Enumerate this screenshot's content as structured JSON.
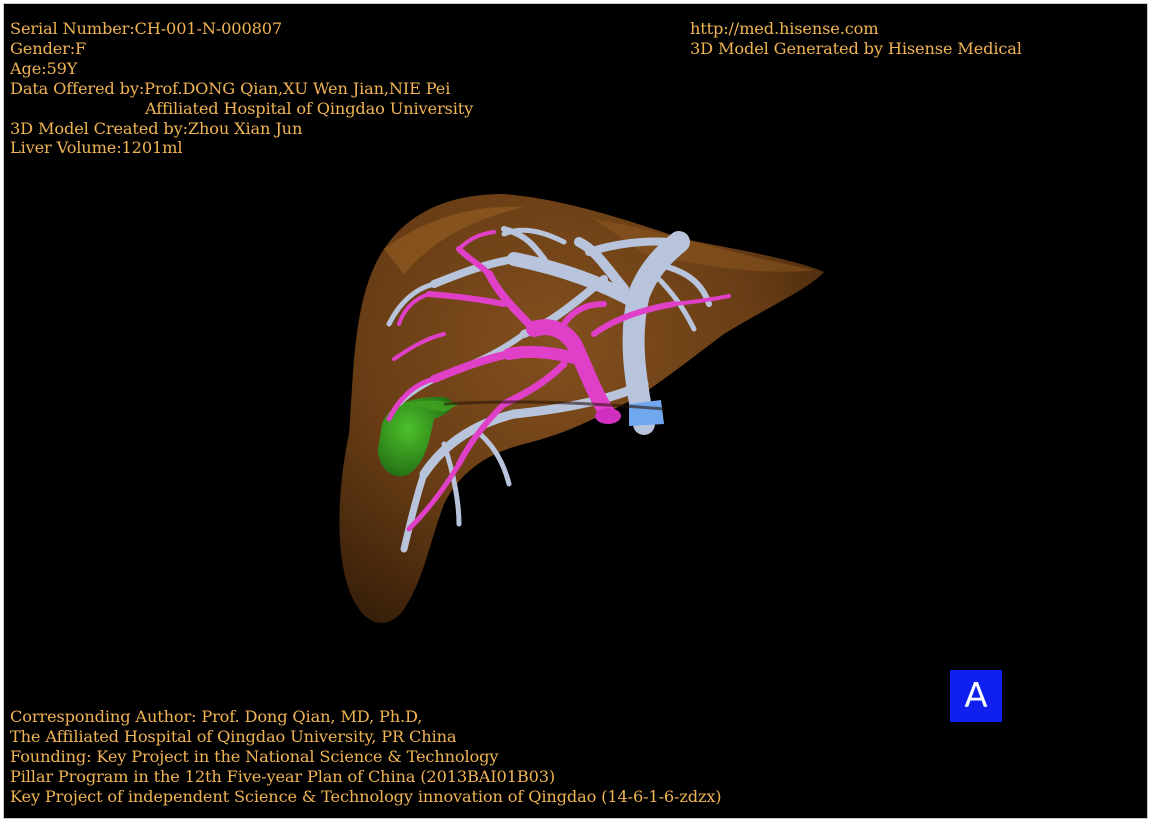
{
  "header_left": {
    "serial_number": "Serial Number:CH-001-N-000807",
    "gender": "Gender:F",
    "age": "Age:59Y",
    "data_offered_by": "Data Offered by:Prof.DONG Qian,XU Wen Jian,NIE Pei",
    "hospital": "Affiliated Hospital of Qingdao University",
    "model_created_by": "3D Model Created by:Zhou Xian Jun",
    "liver_volume": "Liver Volume:1201ml"
  },
  "header_right": {
    "url": "http://med.hisense.com",
    "generator": "3D Model Generated by Hisense Medical"
  },
  "footer": {
    "line1": "Corresponding Author: Prof. Dong Qian, MD, Ph.D,",
    "line2": "The Affiliated Hospital of Qingdao University, PR China",
    "line3": "Founding: Key Project in the National Science & Technology",
    "line4": "Pillar Program in the 12th Five-year Plan of China (2013BAI01B03)",
    "line5": "Key Project of independent Science & Technology innovation of Qingdao (14-6-1-6-zdzx)"
  },
  "panel_label": "A",
  "colors": {
    "text": "#f0b454",
    "background": "#000000",
    "liver": "#7a4a1a",
    "portal_vein": "#e040c8",
    "hepatic_vein": "#b8c4dc",
    "gallbladder": "#2e8a1e",
    "badge": "#0f20ee"
  }
}
